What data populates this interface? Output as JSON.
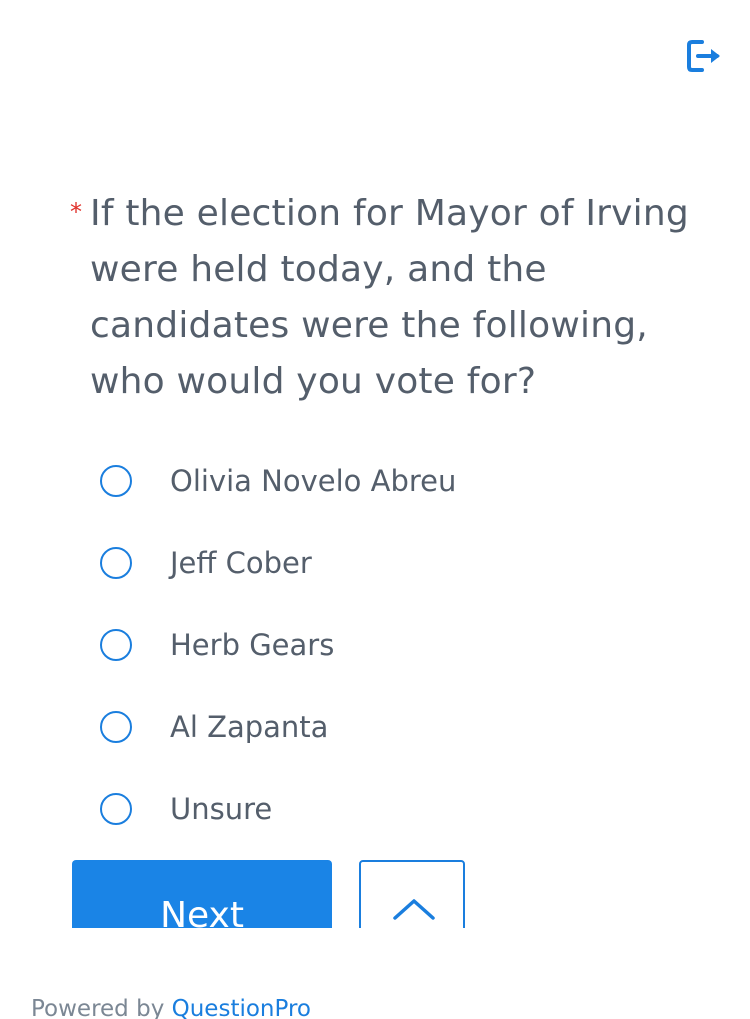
{
  "header": {
    "exit_icon": "exit-icon"
  },
  "question": {
    "required_marker": "*",
    "text": "If the election for Mayor of Irving were held today, and the candidates were the following, who would you vote for?",
    "options": [
      {
        "label": "Olivia Novelo Abreu",
        "selected": false
      },
      {
        "label": "Jeff Cober",
        "selected": false
      },
      {
        "label": "Herb Gears",
        "selected": false
      },
      {
        "label": "Al Zapanta",
        "selected": false
      },
      {
        "label": "Unsure",
        "selected": false
      }
    ]
  },
  "navigation": {
    "next_label": "Next",
    "back_icon": "chevron-up-icon"
  },
  "footer": {
    "powered_by": "Powered by",
    "brand": "QuestionPro"
  },
  "colors": {
    "accent": "#1a84e6",
    "text": "#545e6b",
    "required": "#e0312b"
  }
}
